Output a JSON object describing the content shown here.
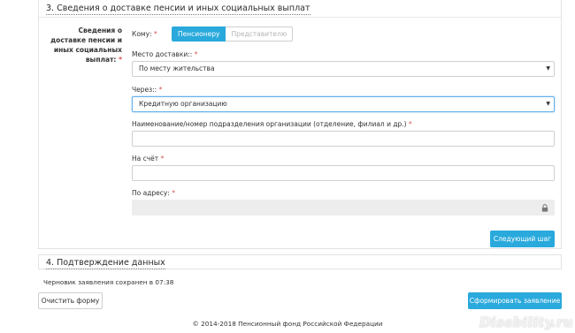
{
  "section3": {
    "title": "3. Сведения о доставке пенсии и иных социальных выплат",
    "side_label": "Сведения о доставке пенсии и иных социальных выплат:",
    "required_mark": "*"
  },
  "recipient": {
    "label": "Кому:",
    "required_mark": "*",
    "options": [
      "Пенсионеру",
      "Представителю"
    ],
    "selected": "Пенсионеру"
  },
  "delivery_place": {
    "label": "Место доставки::",
    "required_mark": "*",
    "value": "По месту жительства"
  },
  "via": {
    "label": "Через::",
    "required_mark": "*",
    "value": "Кредитную организацию"
  },
  "org_name": {
    "label": "Наименование/номер подразделения организации (отделение, филиал и др.)",
    "required_mark": "*",
    "value": ""
  },
  "account": {
    "label": "На счёт",
    "required_mark": "*",
    "value": ""
  },
  "address": {
    "label": "По адресу:",
    "required_mark": "*",
    "value": ""
  },
  "buttons": {
    "next_step": "Следующий шаг",
    "clear_form": "Очистить форму",
    "submit": "Сформировать заявление"
  },
  "section4": {
    "title": "4. Подтверждение данных"
  },
  "draft_status": "Черновик заявления сохранен в 07:38",
  "footer": "© 2014-2018 Пенсионный фонд Российской Федерации",
  "watermark": "Disability.ru",
  "colors": {
    "accent": "#29a9dc",
    "required": "#d9534f",
    "disabled_bg": "#ededed"
  }
}
